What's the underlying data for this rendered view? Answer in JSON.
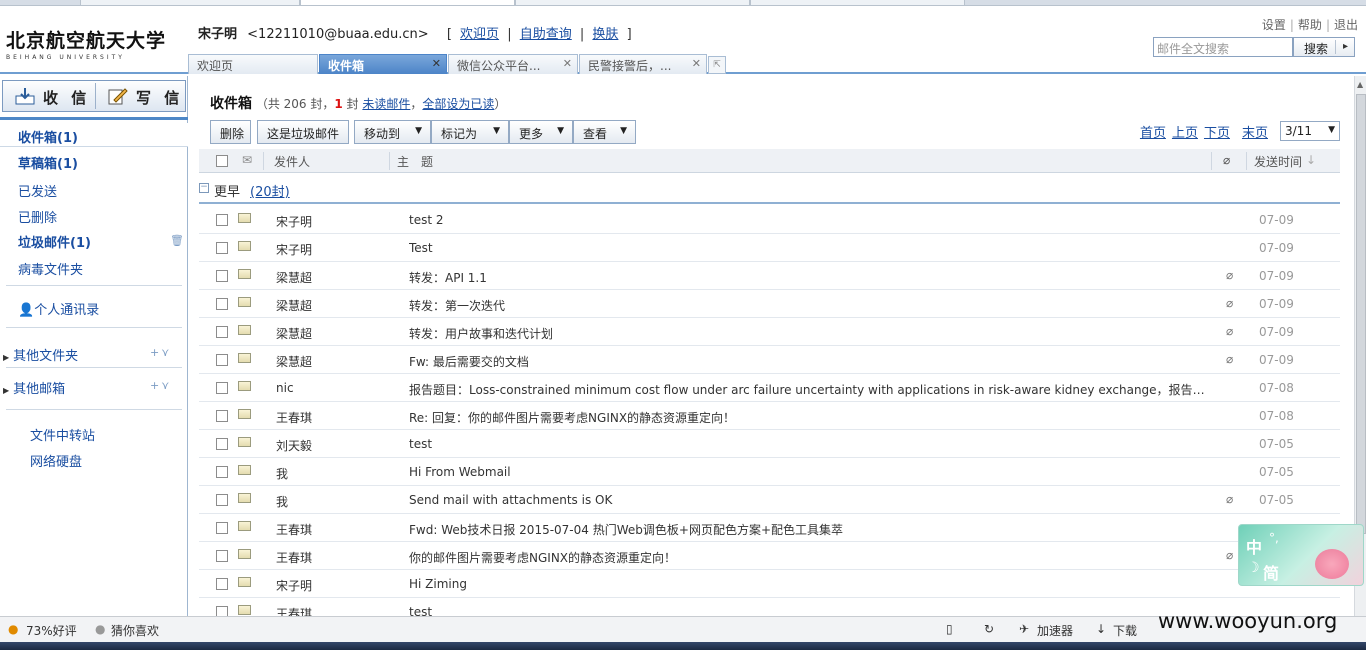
{
  "header": {
    "logo_cn": "北京航空航天大学",
    "logo_en": "BEIHANG UNIVERSITY",
    "user_name": "宋子明",
    "user_email": "<12211010@buaa.edu.cn>",
    "links": [
      "欢迎页",
      "自助查询",
      "换肤"
    ],
    "top_links": [
      "设置",
      "帮助",
      "退出"
    ],
    "search_placeholder": "邮件全文搜索",
    "search_button": "搜索"
  },
  "tabs": [
    {
      "label": "欢迎页",
      "active": false
    },
    {
      "label": "收件箱",
      "active": true
    },
    {
      "label": "微信公众平台...",
      "active": false
    },
    {
      "label": "民警接警后，...",
      "active": false
    }
  ],
  "sidebar": {
    "receive_label": "收 信",
    "compose_label": "写 信",
    "folders": [
      {
        "label": "收件箱",
        "count": "(1)"
      },
      {
        "label": "草稿箱",
        "count": "(1)"
      },
      {
        "label": "已发送",
        "count": ""
      },
      {
        "label": "已删除",
        "count": ""
      },
      {
        "label": "垃圾邮件",
        "count": "(1)"
      },
      {
        "label": "病毒文件夹",
        "count": ""
      }
    ],
    "contacts": "个人通讯录",
    "other_folders": "其他文件夹",
    "other_mailboxes": "其他邮箱",
    "transfer": "文件中转站",
    "netdisk": "网络硬盘"
  },
  "main": {
    "title": "收件箱",
    "summary_prefix": "（共 206 封，",
    "unread_count": "1",
    "summary_mid": " 封 ",
    "unread_link": "未读邮件",
    "comma": "，",
    "mark_all_read": "全部设为已读",
    "summary_suffix": "）",
    "toolbar": {
      "delete": "删除",
      "spam": "这是垃圾邮件",
      "move": "移动到",
      "mark": "标记为",
      "more": "更多",
      "view": "查看"
    },
    "pager": {
      "first": "首页",
      "prev": "上页",
      "next": "下页",
      "last": "末页",
      "page": "3/11"
    },
    "columns": {
      "sender": "发件人",
      "subject": "主　题",
      "time": "发送时间"
    },
    "group": {
      "label": "更早",
      "count": "(20封)"
    }
  },
  "emails": [
    {
      "sender": "宋子明",
      "subject": "test 2",
      "attach": false,
      "date": "07-09"
    },
    {
      "sender": "宋子明",
      "subject": "Test",
      "attach": false,
      "date": "07-09"
    },
    {
      "sender": "梁慧超",
      "subject": "转发：API 1.1",
      "attach": true,
      "date": "07-09"
    },
    {
      "sender": "梁慧超",
      "subject": "转发：第一次迭代",
      "attach": true,
      "date": "07-09"
    },
    {
      "sender": "梁慧超",
      "subject": "转发：用户故事和迭代计划",
      "attach": true,
      "date": "07-09"
    },
    {
      "sender": "梁慧超",
      "subject": "Fw: 最后需要交的文档",
      "attach": true,
      "date": "07-09"
    },
    {
      "sender": "nic",
      "subject": "报告题目：Loss-constrained minimum cost flow under arc failure uncertainty with applications in risk-aware kidney exchange，报告人：Qipeng P...",
      "attach": false,
      "date": "07-08"
    },
    {
      "sender": "王春琪",
      "subject": "Re: 回复：你的邮件图片需要考虑NGINX的静态资源重定向！",
      "attach": false,
      "date": "07-08"
    },
    {
      "sender": "刘天毅",
      "subject": "test",
      "attach": false,
      "date": "07-05"
    },
    {
      "sender": "我",
      "subject": "Hi From Webmail",
      "attach": false,
      "date": "07-05"
    },
    {
      "sender": "我",
      "subject": "Send mail with attachments is OK",
      "attach": true,
      "date": "07-05"
    },
    {
      "sender": "王春琪",
      "subject": "Fwd: Web技术日报 2015-07-04 热门Web调色板+网页配色方案+配色工具集萃",
      "attach": false,
      "date": ""
    },
    {
      "sender": "王春琪",
      "subject": "你的邮件图片需要考虑NGINX的静态资源重定向！",
      "attach": true,
      "date": ""
    },
    {
      "sender": "宋子明",
      "subject": "Hi Ziming",
      "attach": false,
      "date": ""
    },
    {
      "sender": "王春琪",
      "subject": "test",
      "attach": false,
      "date": ""
    }
  ],
  "ime": {
    "k1": "中",
    "k2": "°,",
    "k3": "☽",
    "k4": "简"
  },
  "statusbar": {
    "rating": "73%好评",
    "guess": "猜你喜欢",
    "accelerator": "加速器",
    "download": "下载"
  },
  "watermark": "www.wooyun.org"
}
